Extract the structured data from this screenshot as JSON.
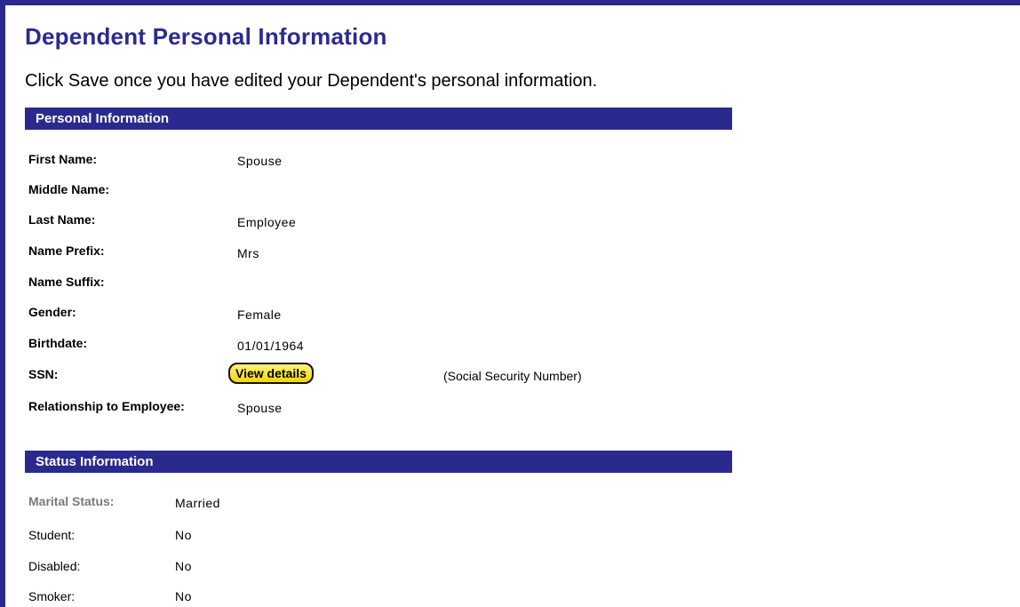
{
  "page": {
    "title": "Dependent Personal Information",
    "instructions": "Click Save once you have edited your Dependent's personal information."
  },
  "personal": {
    "header": "Personal Information",
    "first_name_label": "First Name:",
    "first_name": "Spouse",
    "middle_name_label": "Middle Name:",
    "middle_name": "",
    "last_name_label": "Last Name:",
    "last_name": "Employee",
    "prefix_label": "Name Prefix:",
    "prefix": "Mrs",
    "suffix_label": "Name Suffix:",
    "suffix": "",
    "gender_label": "Gender:",
    "gender": "Female",
    "birthdate_label": "Birthdate:",
    "birthdate": "01/01/1964",
    "ssn_label": "SSN:",
    "ssn_button": "View details",
    "ssn_note": "(Social Security Number)",
    "relationship_label": "Relationship to Employee:",
    "relationship": "Spouse"
  },
  "status": {
    "header": "Status Information",
    "marital_label": "Marital Status:",
    "marital": "Married",
    "student_label": "Student:",
    "student": "No",
    "disabled_label": "Disabled:",
    "disabled": "No",
    "smoker_label": "Smoker:",
    "smoker": "No"
  },
  "colors": {
    "header_bg": "#2a2a8e",
    "title": "#2b2b8f",
    "button": "#f3d800"
  }
}
